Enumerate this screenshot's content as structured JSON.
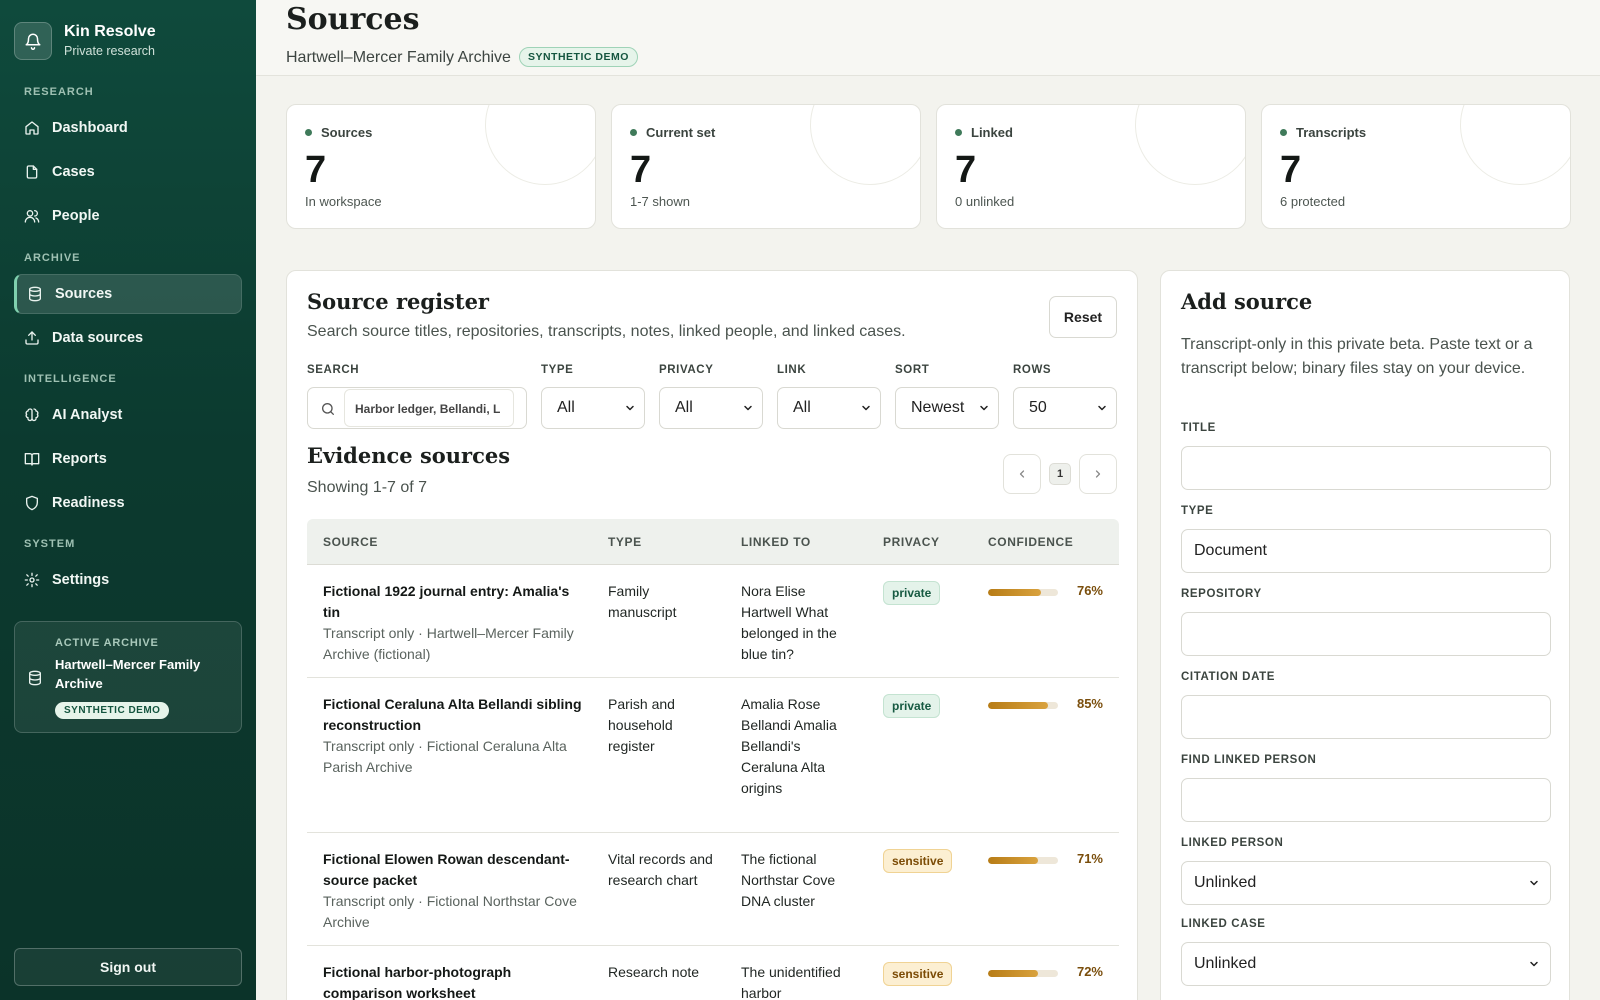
{
  "brand": {
    "name": "Kin Resolve",
    "subtitle": "Private research"
  },
  "nav": {
    "sections": {
      "research": "RESEARCH",
      "archive": "ARCHIVE",
      "intelligence": "INTELLIGENCE",
      "system": "SYSTEM"
    },
    "items": {
      "dashboard": "Dashboard",
      "cases": "Cases",
      "people": "People",
      "sources": "Sources",
      "data_sources": "Data sources",
      "ai_analyst": "AI Analyst",
      "reports": "Reports",
      "readiness": "Readiness",
      "settings": "Settings"
    },
    "active": "sources"
  },
  "active_archive": {
    "label": "ACTIVE ARCHIVE",
    "name": "Hartwell–Mercer Family Archive",
    "badge": "SYNTHETIC DEMO"
  },
  "sign_out": "Sign out",
  "header": {
    "title": "Sources",
    "subtitle": "Hartwell–Mercer Family Archive",
    "badge": "SYNTHETIC DEMO"
  },
  "stats": [
    {
      "label": "Sources",
      "value": "7",
      "note": "In workspace"
    },
    {
      "label": "Current set",
      "value": "7",
      "note": "1-7 shown"
    },
    {
      "label": "Linked",
      "value": "7",
      "note": "0 unlinked"
    },
    {
      "label": "Transcripts",
      "value": "7",
      "note": "6 protected"
    }
  ],
  "register": {
    "title": "Source register",
    "description": "Search source titles, repositories, transcripts, notes, linked people, and linked cases.",
    "reset": "Reset",
    "filters": {
      "search_label": "SEARCH",
      "search_value": "Harbor ledger, Bellandi, L",
      "type_label": "TYPE",
      "type_value": "All",
      "privacy_label": "PRIVACY",
      "privacy_value": "All",
      "link_label": "LINK",
      "link_value": "All",
      "sort_label": "SORT",
      "sort_value": "Newest",
      "rows_label": "ROWS",
      "rows_value": "50"
    }
  },
  "evidence": {
    "title": "Evidence sources",
    "showing": "Showing 1-7 of 7",
    "page": "1",
    "columns": {
      "source": "SOURCE",
      "type": "TYPE",
      "linked_to": "LINKED TO",
      "privacy": "PRIVACY",
      "confidence": "CONFIDENCE"
    },
    "rows": [
      {
        "title": "Fictional 1922 journal entry: Amalia's tin",
        "meta": "Transcript only · Hartwell–Mercer Family Archive (fictional)",
        "type": "Family manuscript",
        "linked": "Nora Elise Hartwell What belonged in the blue tin?",
        "privacy": "private",
        "confidence": 76,
        "confidence_label": "76%"
      },
      {
        "title": "Fictional Ceraluna Alta Bellandi sibling reconstruction",
        "meta": "Transcript only · Fictional Ceraluna Alta Parish Archive",
        "type": "Parish and household register",
        "linked": "Amalia Rose Bellandi Amalia Bellandi's Ceraluna Alta origins",
        "privacy": "private",
        "confidence": 85,
        "confidence_label": "85%"
      },
      {
        "title": "Fictional Elowen Rowan descendant-source packet",
        "meta": "Transcript only · Fictional Northstar Cove Archive",
        "type": "Vital records and research chart",
        "linked": "The fictional Northstar Cove DNA cluster",
        "privacy": "sensitive",
        "confidence": 71,
        "confidence_label": "71%"
      },
      {
        "title": "Fictional harbor-photograph comparison worksheet",
        "meta": "",
        "type": "Research note",
        "linked": "The unidentified harbor",
        "privacy": "sensitive",
        "confidence": 72,
        "confidence_label": "72%"
      }
    ]
  },
  "add_source": {
    "title": "Add source",
    "description": "Transcript-only in this private beta. Paste text or a transcript below; binary files stay on your device.",
    "fields": {
      "title_label": "TITLE",
      "title_value": "",
      "type_label": "TYPE",
      "type_value": "Document",
      "repository_label": "REPOSITORY",
      "repository_value": "",
      "citation_date_label": "CITATION DATE",
      "citation_date_value": "",
      "find_person_label": "FIND LINKED PERSON",
      "find_person_value": "",
      "linked_person_label": "LINKED PERSON",
      "linked_person_value": "Unlinked",
      "linked_case_label": "LINKED CASE",
      "linked_case_value": "Unlinked"
    }
  },
  "colors": {
    "sidebar": "#0f4a3c",
    "accent": "#7fd0ae",
    "private": "#175a42",
    "sensitive": "#7b4b05",
    "confidence": "#c28a25"
  }
}
